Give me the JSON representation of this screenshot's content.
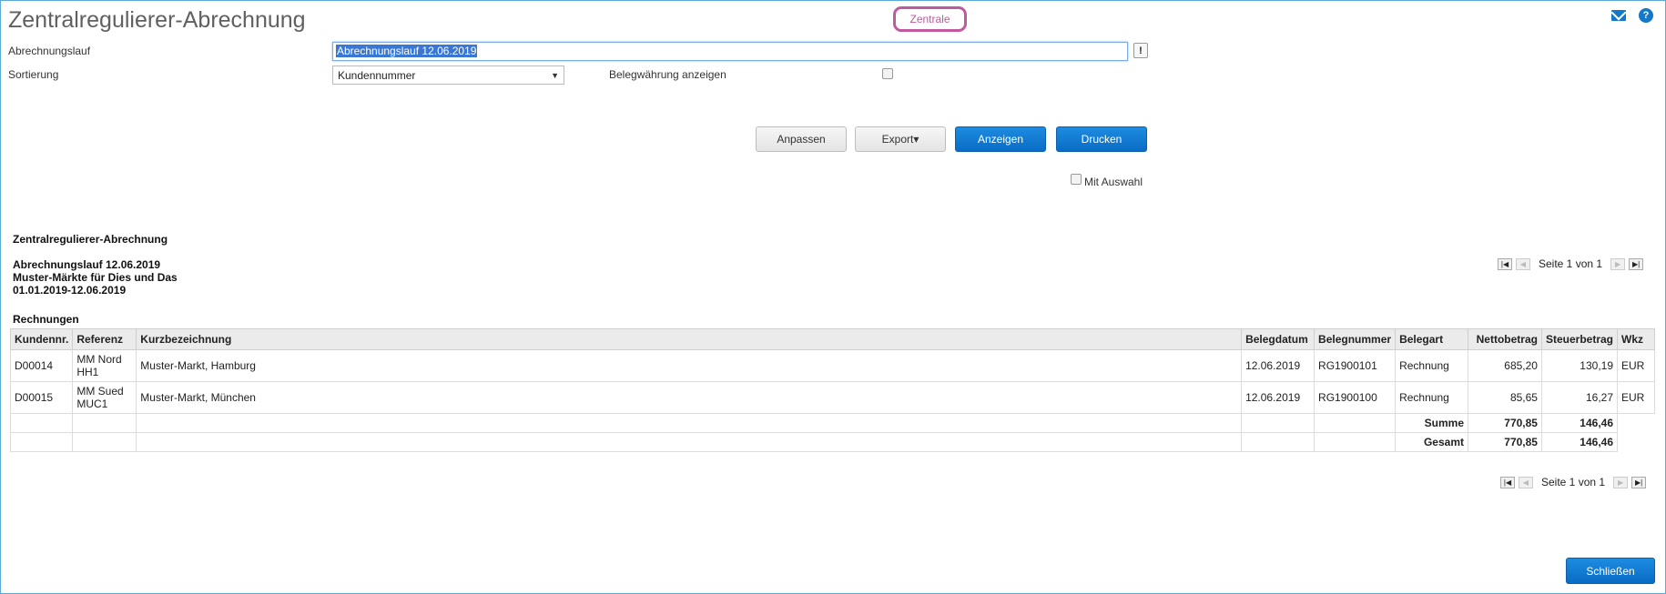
{
  "header": {
    "title": "Zentralregulierer-Abrechnung",
    "badge": "Zentrale",
    "mail_icon": "mail-icon",
    "help_icon": "help-icon",
    "help_glyph": "?"
  },
  "form": {
    "run_label": "Abrechnungslauf",
    "run_value": "Abrechnungslauf 12.06.2019",
    "excl_button": "!",
    "sort_label": "Sortierung",
    "sort_value": "Kundennummer",
    "currency_label": "Belegwährung anzeigen",
    "currency_checked": false
  },
  "toolbar": {
    "anpassen": "Anpassen",
    "export": "Export▾",
    "anzeigen": "Anzeigen",
    "drucken": "Drucken",
    "mit_auswahl": "Mit Auswahl"
  },
  "report": {
    "title": "Zentralregulierer-Abrechnung",
    "run": "Abrechnungslauf 12.06.2019",
    "company": "Muster-Märkte für Dies und Das",
    "period": "01.01.2019-12.06.2019",
    "section": "Rechnungen"
  },
  "pager": {
    "text": "Seite 1 von 1",
    "first": "|◀",
    "prev": "◀",
    "next": "▶",
    "last": "▶|"
  },
  "table": {
    "headers": {
      "kundennr": "Kundennr.",
      "referenz": "Referenz",
      "kurzbez": "Kurzbezeichnung",
      "belegdatum": "Belegdatum",
      "belegnummer": "Belegnummer",
      "belegart": "Belegart",
      "netto": "Nettobetrag",
      "steuer": "Steuerbetrag",
      "wkz": "Wkz"
    },
    "rows": [
      {
        "kundennr": "D00014",
        "ref1": "MM Nord",
        "ref2": "HH1",
        "kurzbez": "Muster-Markt, Hamburg",
        "belegdatum": "12.06.2019",
        "belegnummer": "RG1900101",
        "belegart": "Rechnung",
        "netto": "685,20",
        "steuer": "130,19",
        "wkz": "EUR"
      },
      {
        "kundennr": "D00015",
        "ref1": "MM Sued",
        "ref2": "MUC1",
        "kurzbez": "Muster-Markt, München",
        "belegdatum": "12.06.2019",
        "belegnummer": "RG1900100",
        "belegart": "Rechnung",
        "netto": "85,65",
        "steuer": "16,27",
        "wkz": "EUR"
      }
    ],
    "summe": {
      "label": "Summe",
      "netto": "770,85",
      "steuer": "146,46"
    },
    "gesamt": {
      "label": "Gesamt",
      "netto": "770,85",
      "steuer": "146,46"
    }
  },
  "footer": {
    "close": "Schließen"
  }
}
